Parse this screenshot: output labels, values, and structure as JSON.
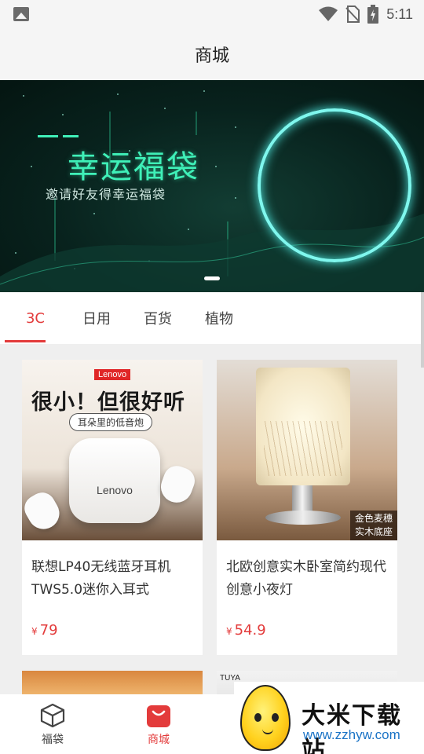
{
  "status_bar": {
    "time": "5:11"
  },
  "header": {
    "title": "商城"
  },
  "banner": {
    "title": "幸运福袋",
    "subtitle": "邀请好友得幸运福袋",
    "accent_color": "#3ff0b8"
  },
  "tabs": [
    {
      "label": "3C",
      "active": true
    },
    {
      "label": "日用",
      "active": false
    },
    {
      "label": "百货",
      "active": false
    },
    {
      "label": "植物",
      "active": false
    }
  ],
  "products": [
    {
      "name": "联想LP40无线蓝牙耳机TWS5.0迷你入耳式",
      "price_symbol": "¥",
      "price": "79",
      "image": {
        "brand_tag": "Lenovo",
        "slogan": "很小！但很好听",
        "sub": "耳朵里的低音炮",
        "case_logo": "Lenovo"
      }
    },
    {
      "name": "北欧创意实木卧室简约现代创意小夜灯",
      "price_symbol": "¥",
      "price": "54.9",
      "image": {
        "tag_line1": "金色麦穗",
        "tag_line2": "实木底座"
      }
    }
  ],
  "partial_row": {
    "right_image_text": "TUYA"
  },
  "bottom_nav": [
    {
      "label": "福袋",
      "icon": "cube-icon",
      "active": false
    },
    {
      "label": "商城",
      "icon": "shopping-bag-icon",
      "active": true
    }
  ],
  "watermark": {
    "brand": "大米下载站",
    "site": "www.zzhyw.com"
  },
  "colors": {
    "accent": "#e33b3b",
    "background": "#efefef"
  }
}
